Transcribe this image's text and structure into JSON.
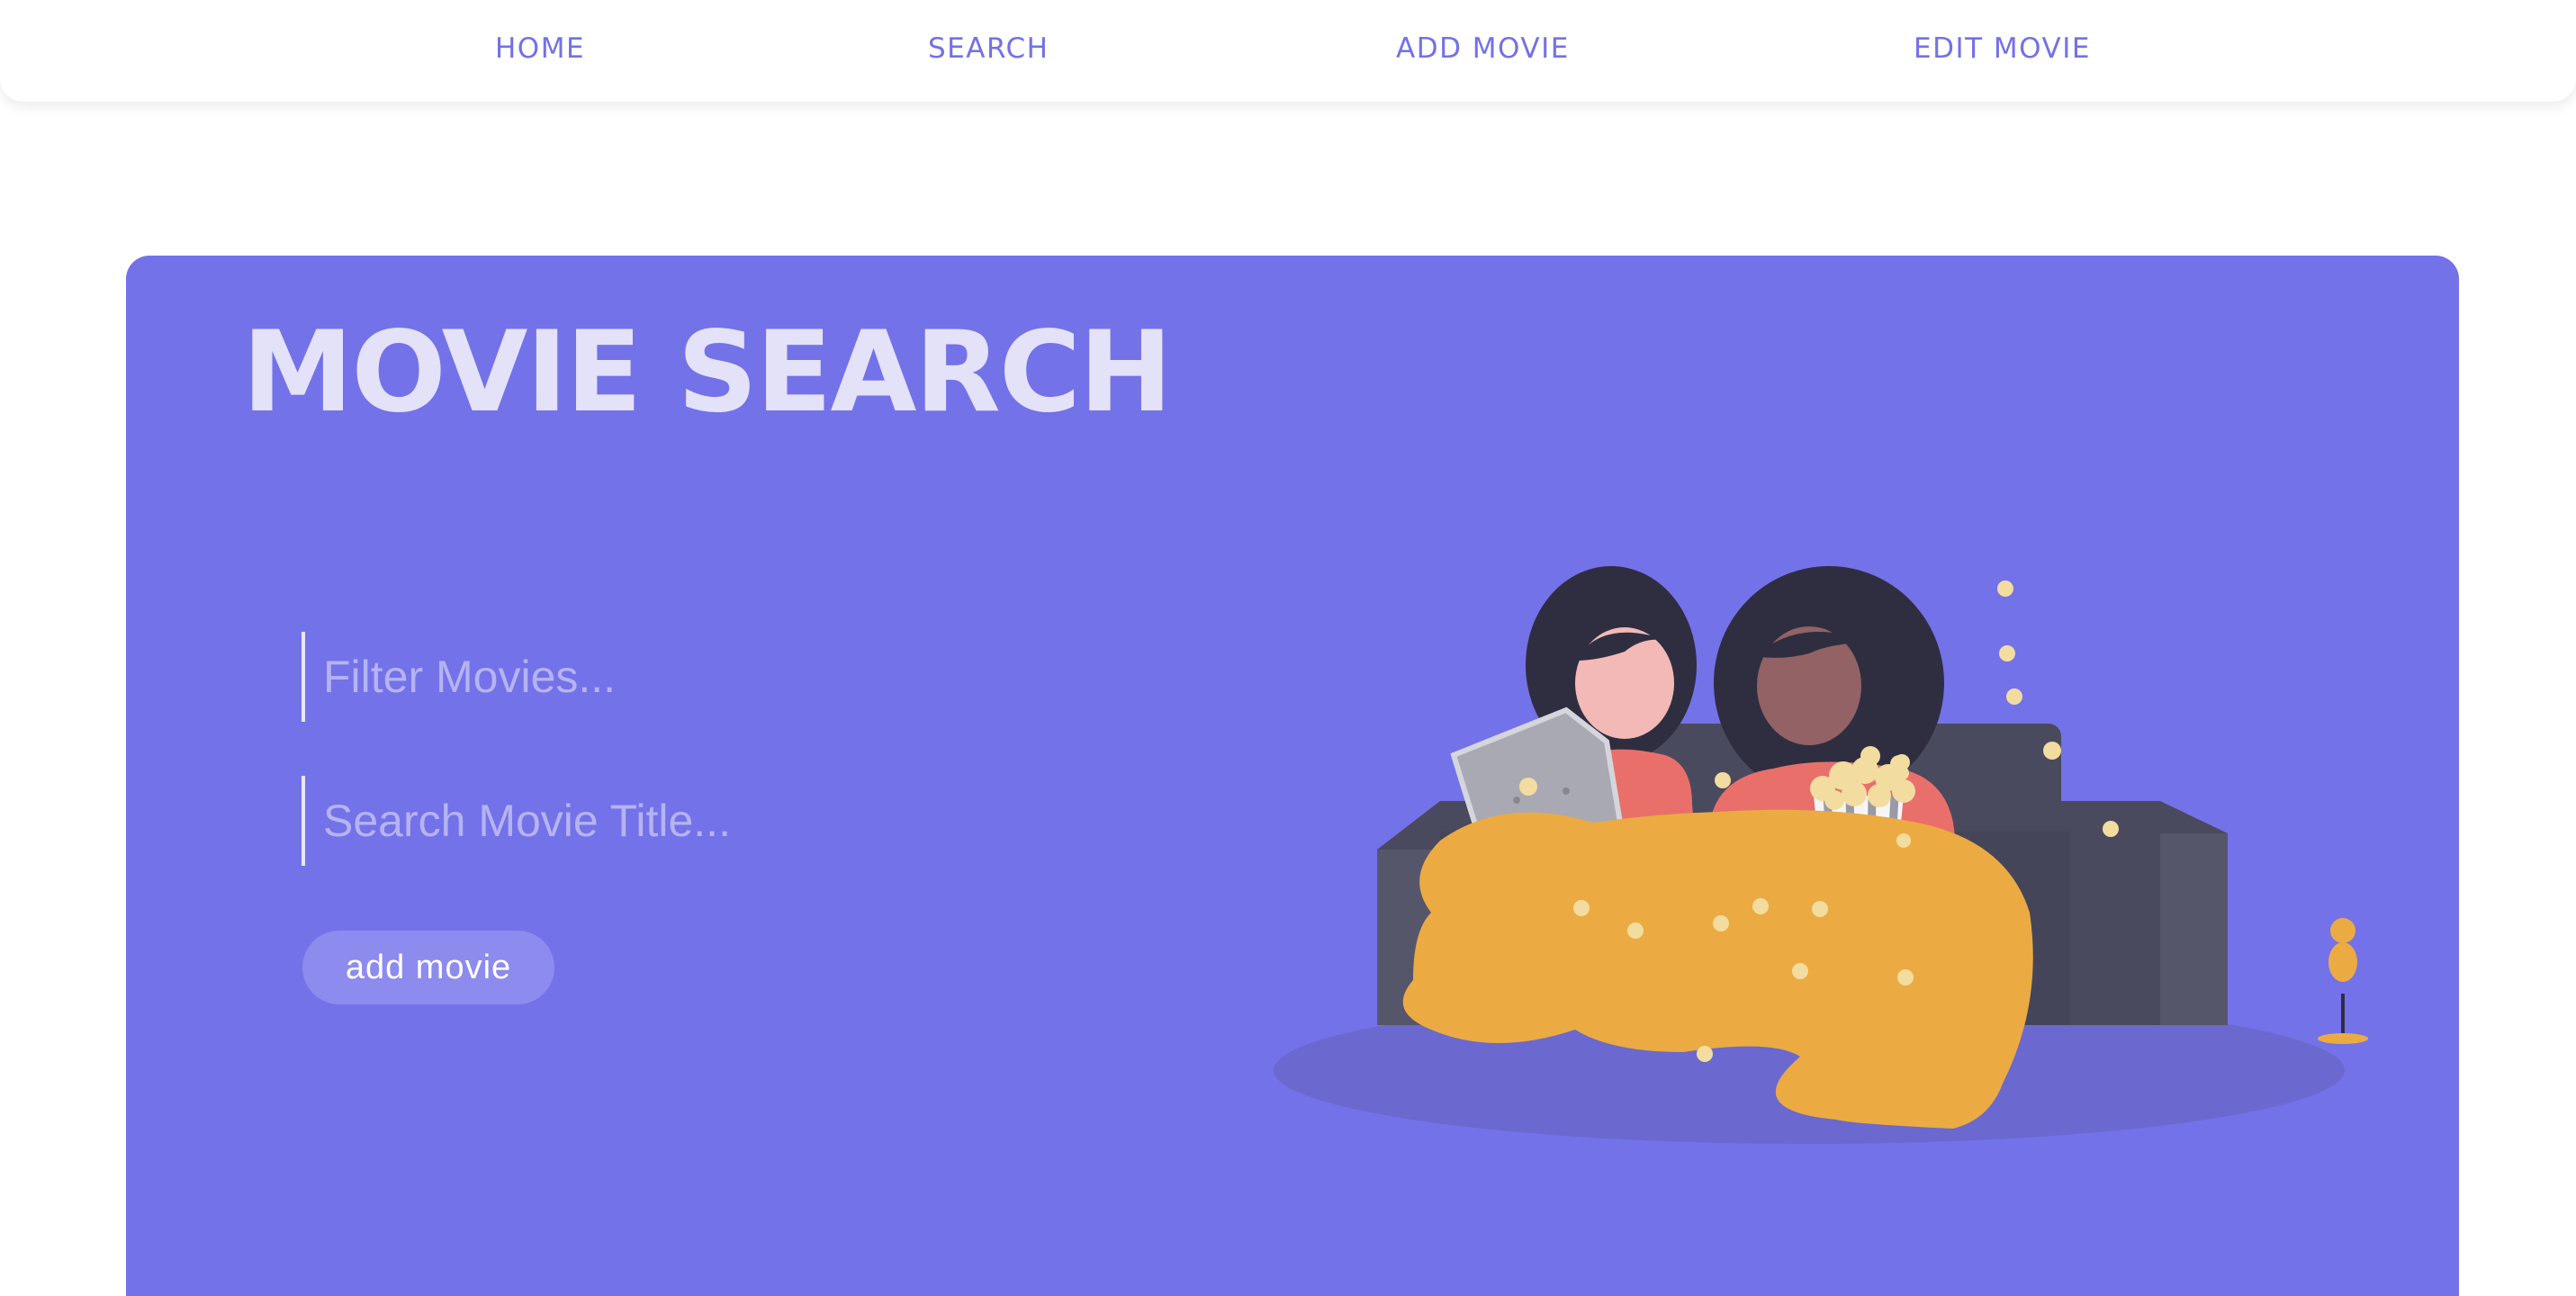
{
  "nav": {
    "home": "HOME",
    "search": "SEARCH",
    "add_movie": "ADD MOVIE",
    "edit_movie": "EDIT MOVIE"
  },
  "hero": {
    "title": "MOVIE SEARCH",
    "filter_placeholder": "Filter Movies...",
    "search_placeholder": "Search Movie Title...",
    "add_button": "add movie"
  },
  "colors": {
    "accent": "#7472e8",
    "nav_text": "#7271e8",
    "title_text": "#e3e2f8",
    "button_bg": "#8d8bee"
  },
  "illustration": {
    "icon": "couch-movie-night-illustration"
  }
}
